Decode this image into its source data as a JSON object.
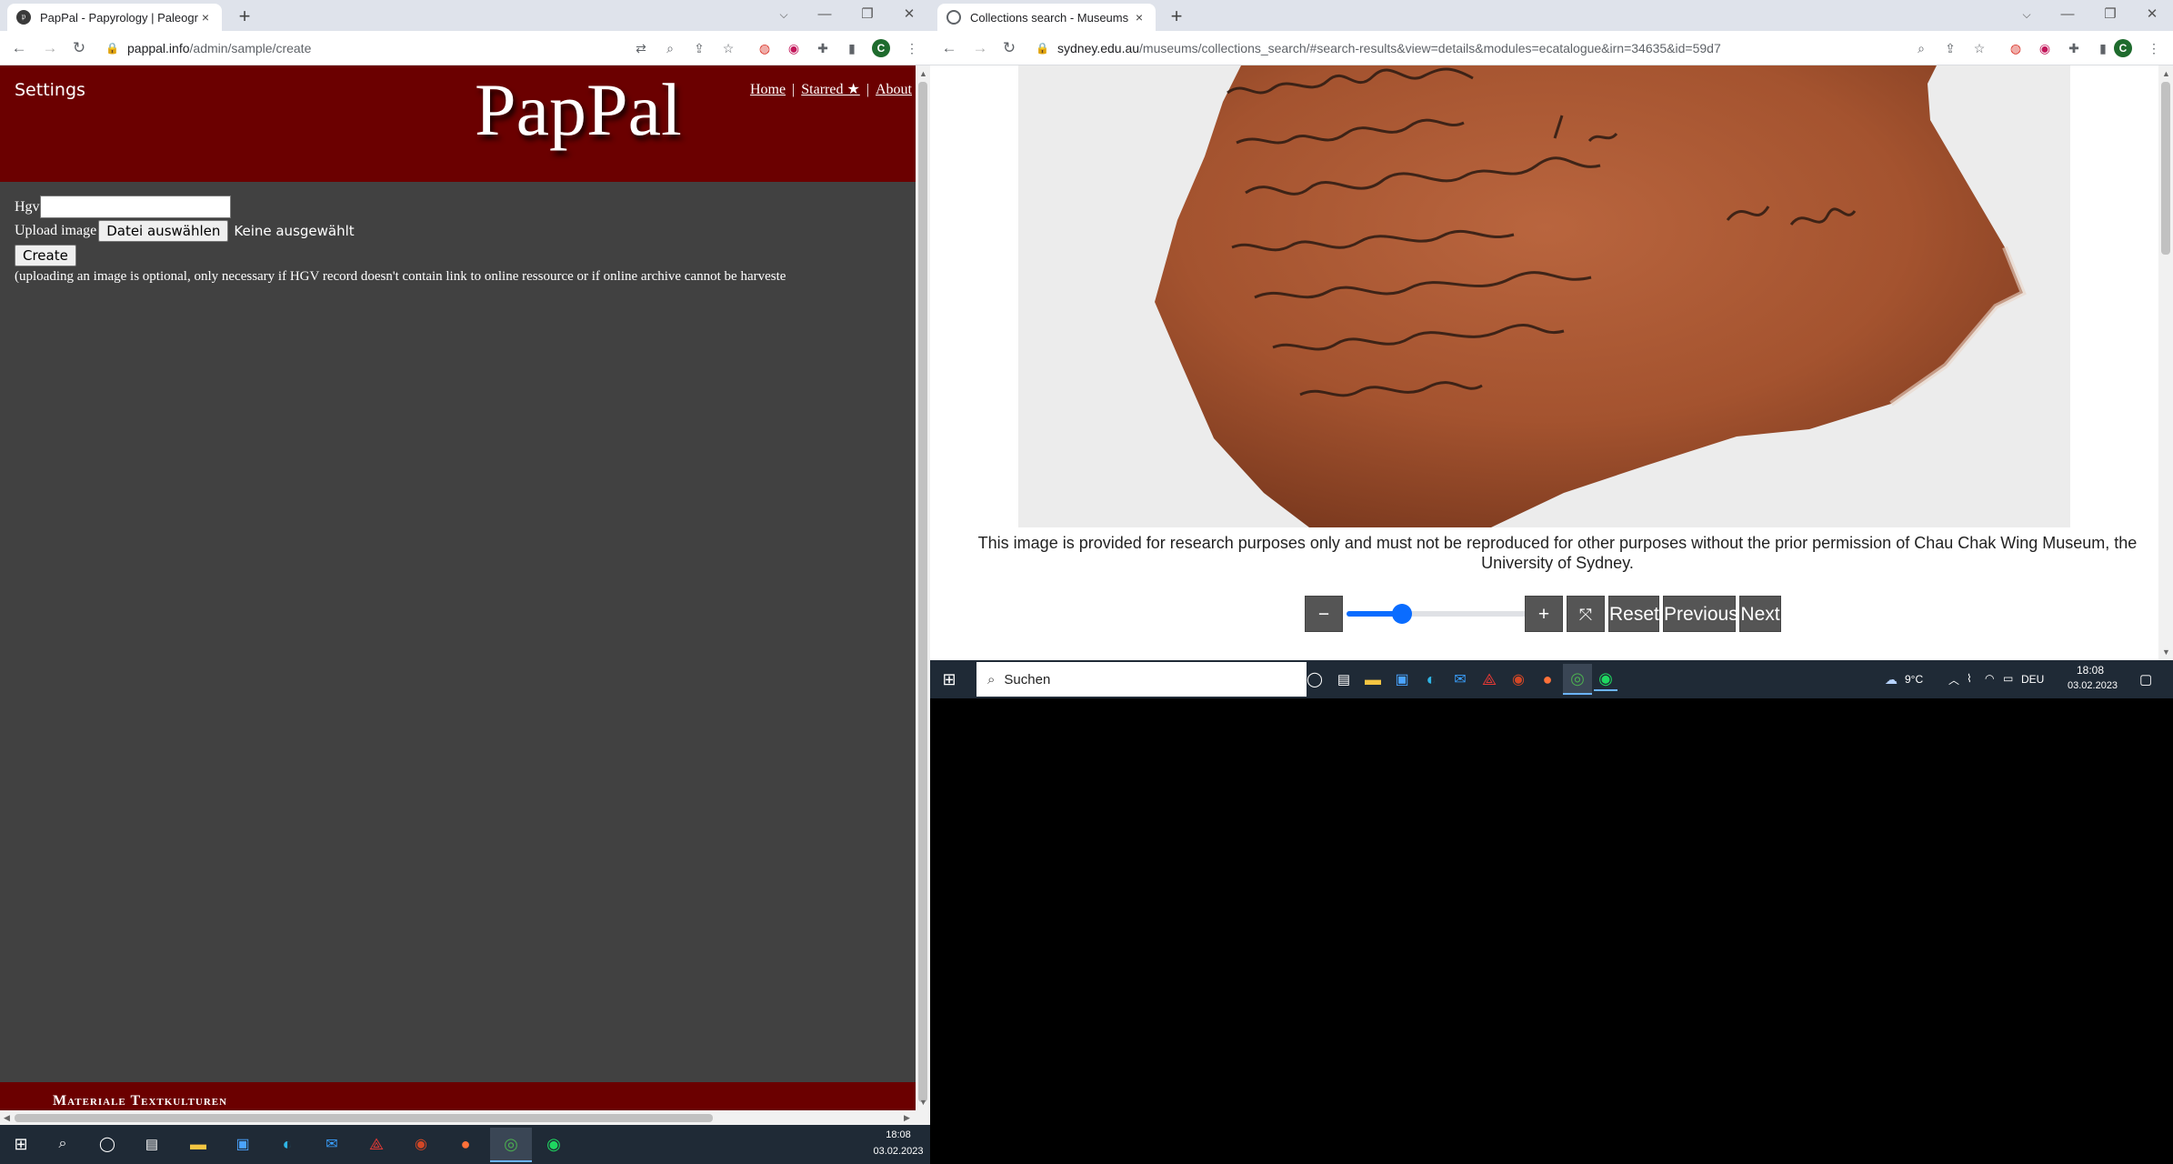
{
  "left_browser": {
    "tab": {
      "title": "PapPal - Papyrology | Paleography",
      "close": "×"
    },
    "new_tab": "+",
    "controls": {
      "dropdown": "⌵",
      "minimize": "—",
      "restore": "❐",
      "close": "✕"
    },
    "nav": {
      "back": "←",
      "forward": "→",
      "reload": "↻"
    },
    "url": {
      "host": "pappal.info",
      "path": "/admin/sample/create"
    },
    "extensions": [
      "translate-icon",
      "zoom-icon",
      "share-icon",
      "star-icon",
      "ext-red-icon",
      "ext-pink-icon",
      "puzzle-icon",
      "sidebar-icon"
    ],
    "avatar": "C",
    "menu": "⋮"
  },
  "pappal": {
    "settings": "Settings",
    "logo": "PapPal",
    "nav": [
      {
        "label": "Home"
      },
      {
        "label": "Starred ★"
      },
      {
        "label": "About"
      }
    ],
    "nav_sep": "|",
    "hgv_label": "Hgv",
    "hgv_value": "",
    "upload_label": "Upload image",
    "choose_file_button": "Datei auswählen",
    "no_file_text": "Keine ausgewählt",
    "create_button": "Create",
    "hint": "(uploading an image is optional, only necessary if HGV record doesn't contain link to online ressource or if online archive cannot be harveste",
    "footer": "Materiale Textkulturen"
  },
  "right_browser": {
    "tab": {
      "title": "Collections search - Museums - T",
      "close": "×"
    },
    "new_tab": "+",
    "controls": {
      "dropdown": "⌵",
      "minimize": "—",
      "restore": "❐",
      "close": "✕"
    },
    "nav": {
      "back": "←",
      "forward": "→",
      "reload": "↻"
    },
    "url": {
      "host": "sydney.edu.au",
      "path": "/museums/collections_search/#search-results&view=details&modules=ecatalogue&irn=34635&id=59d7"
    },
    "avatar": "C",
    "menu": "⋮"
  },
  "sydney": {
    "image_alt": "ostracon-sherd",
    "disclaimer": "This image is provided for research purposes only and must not be reproduced for other purposes without the prior permission of Chau Chak Wing Museum, the University of Sydney.",
    "zoom_out": "−",
    "zoom_level": 0.28,
    "zoom_in": "+",
    "fullscreen": "⤧",
    "reset": "Reset",
    "previous": "Previous",
    "next": "Next"
  },
  "taskbar_small": {
    "search_placeholder": "Suchen",
    "weather": "9°C",
    "lang": "DEU",
    "time": "18:08",
    "date": "03.02.2023"
  },
  "taskbar_main": {
    "time": "18:08",
    "date": "03.02.2023"
  },
  "colors": {
    "pappal_red": "#6b0000",
    "pappal_bg": "#414141",
    "taskbar": "#1f2a36",
    "accent": "#0a6cff"
  }
}
